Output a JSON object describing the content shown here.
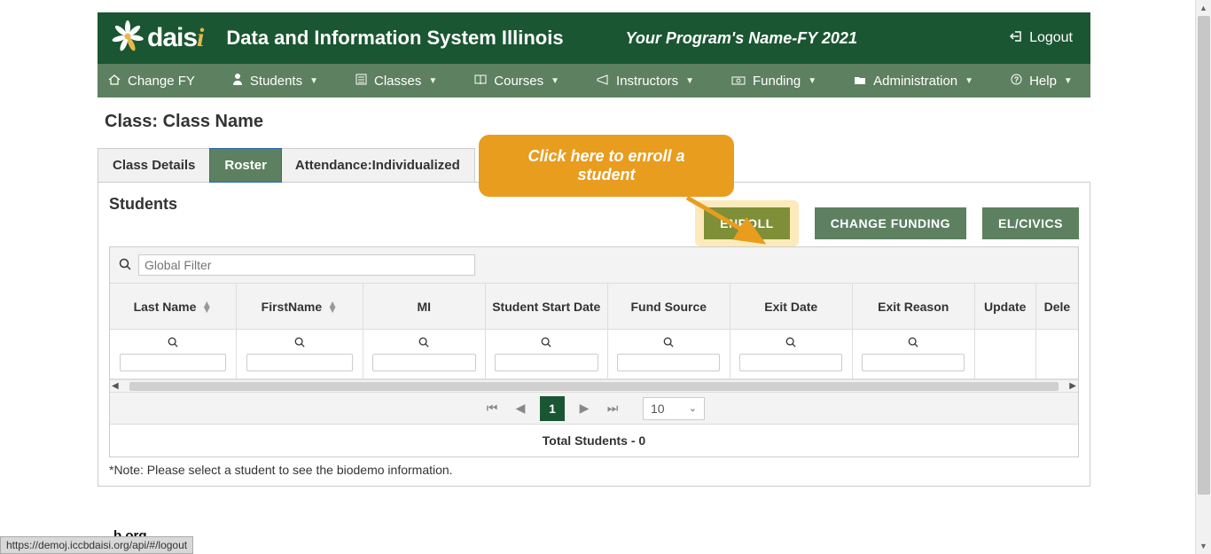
{
  "header": {
    "logo_text": "dais",
    "system_title": "Data and Information System Illinois",
    "program_label": "Your Program's Name-FY 2021",
    "logout": "Logout"
  },
  "nav": {
    "change_fy": "Change FY",
    "students": "Students",
    "classes": "Classes",
    "courses": "Courses",
    "instructors": "Instructors",
    "funding": "Funding",
    "administration": "Administration",
    "help": "Help"
  },
  "page": {
    "title": "Class: Class Name"
  },
  "tabs": {
    "details": "Class Details",
    "roster": "Roster",
    "attendance": "Attendance:Individualized"
  },
  "panel": {
    "title": "Students",
    "buttons": {
      "enroll": "ENROLL",
      "change_funding": "CHANGE FUNDING",
      "el_civics": "EL/CIVICS"
    }
  },
  "grid": {
    "global_filter_placeholder": "Global Filter",
    "columns": {
      "last_name": "Last Name",
      "first_name": "FirstName",
      "mi": "MI",
      "student_start_date": "Student Start Date",
      "fund_source": "Fund Source",
      "exit_date": "Exit Date",
      "exit_reason": "Exit Reason",
      "update": "Update",
      "delete": "Dele"
    },
    "pager": {
      "current_page": "1",
      "page_size": "10"
    },
    "total_label": "Total Students - 0"
  },
  "note": "*Note: Please select a student to see the biodemo information.",
  "callout": {
    "line1": "Click here to enroll a",
    "line2": "student"
  },
  "status_bar": "https://demoj.iccbdaisi.org/api/#/logout",
  "footer_fragment": "b.org"
}
